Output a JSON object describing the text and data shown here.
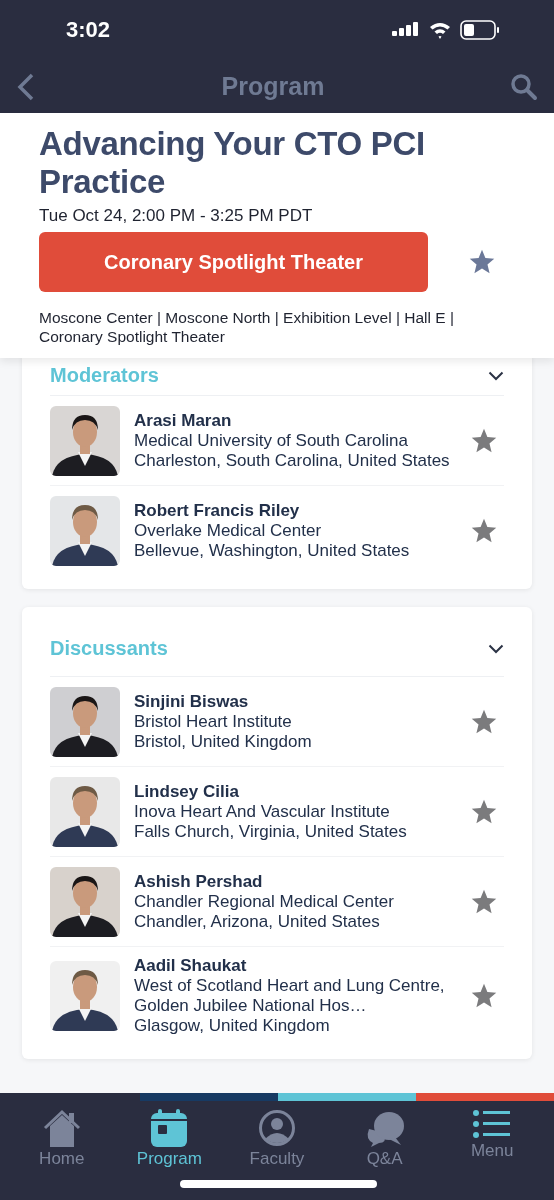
{
  "status_bar": {
    "time": "3:02"
  },
  "nav": {
    "title": "Program"
  },
  "session": {
    "title": "Advancing Your CTO PCI Practice",
    "time": "Tue Oct 24, 2:00 PM - 3:25 PM PDT",
    "track": "Coronary Spotlight Theater",
    "location": "Moscone Center | Moscone North | Exhibition Level | Hall E | Coronary Spotlight Theater"
  },
  "sections": [
    {
      "title": "Moderators",
      "people": [
        {
          "name": "Arasi Maran",
          "org": "Medical University of South Carolina",
          "place": "Charleston, South Carolina, United States"
        },
        {
          "name": "Robert Francis Riley",
          "org": "Overlake Medical Center",
          "place": "Bellevue, Washington, United States"
        }
      ]
    },
    {
      "title": "Discussants",
      "people": [
        {
          "name": "Sinjini Biswas",
          "org": "Bristol Heart Institute",
          "place": "Bristol, United Kingdom"
        },
        {
          "name": "Lindsey Cilia",
          "org": "Inova Heart And Vascular Institute",
          "place": "Falls Church, Virginia, United States"
        },
        {
          "name": "Ashish Pershad",
          "org": "Chandler Regional Medical Center",
          "place": "Chandler, Arizona, United States"
        },
        {
          "name": "Aadil Shaukat",
          "org": "West of Scotland Heart and Lung Centre, Golden Jubilee National Hos…",
          "place": "Glasgow, United Kingdom"
        }
      ]
    }
  ],
  "tab_bar": [
    {
      "kind": "home",
      "label": "Home",
      "selected": false
    },
    {
      "kind": "program",
      "label": "Program",
      "selected": true
    },
    {
      "kind": "faculty",
      "label": "Faculty",
      "selected": false
    },
    {
      "kind": "qa",
      "label": "Q&A",
      "selected": false
    },
    {
      "kind": "menu",
      "label": "Menu",
      "selected": false
    }
  ]
}
